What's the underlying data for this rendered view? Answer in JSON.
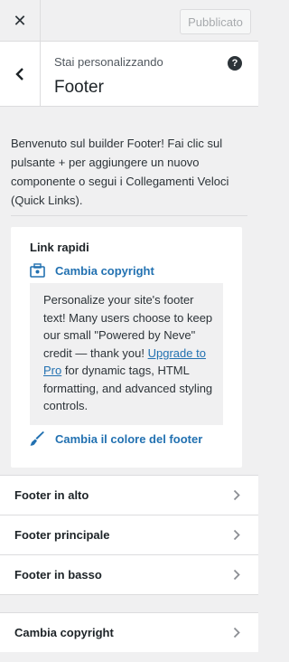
{
  "topbar": {
    "close_label": "✕",
    "publish_label": "Pubblicato"
  },
  "header": {
    "customizing": "Stai personalizzando",
    "title": "Footer",
    "help": "?"
  },
  "intro": "Benvenuto sul builder Footer! Fai clic sul pulsante + per aggiungere un nuovo componente o segui i Collegamenti Veloci (Quick Links).",
  "quick_links": {
    "title": "Link rapidi",
    "change_copyright": "Cambia copyright",
    "promo_text_1": "Personalize your site's footer text! Many users choose to keep our small \"Powered by Neve\" credit — thank you! ",
    "promo_link": "Upgrade to Pro",
    "promo_text_2": " for dynamic tags, HTML formatting, and advanced styling controls.",
    "change_color": "Cambia il colore del footer"
  },
  "nav": {
    "items": [
      {
        "label": "Footer in alto"
      },
      {
        "label": "Footer principale"
      },
      {
        "label": "Footer in basso"
      }
    ],
    "items2": [
      {
        "label": "Cambia copyright"
      }
    ]
  },
  "colors": {
    "accent": "#2271b1",
    "background": "#f0f0f1"
  }
}
